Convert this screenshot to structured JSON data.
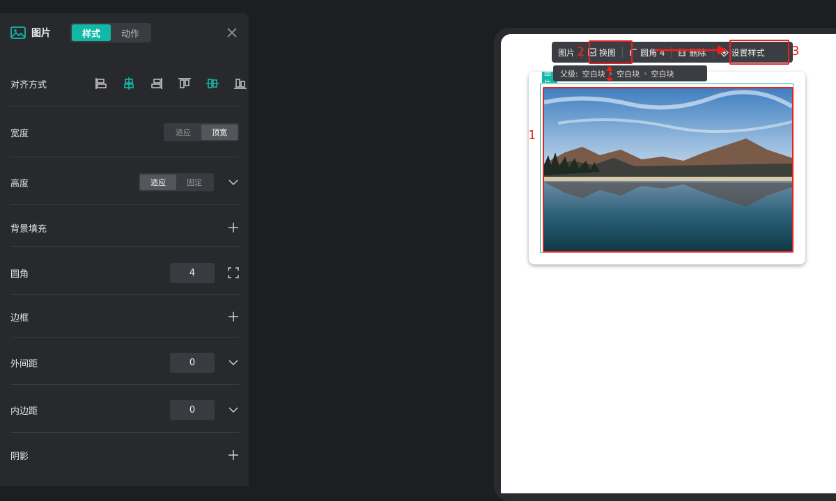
{
  "panel": {
    "title": "图片",
    "tabs": [
      {
        "label": "样式",
        "active": true
      },
      {
        "label": "动作",
        "active": false
      }
    ],
    "rows": {
      "align": {
        "label": "对齐方式"
      },
      "width": {
        "label": "宽度",
        "options": [
          "适应",
          "顶宽"
        ],
        "selected": "顶宽"
      },
      "height": {
        "label": "高度",
        "options": [
          "适应",
          "固定"
        ],
        "selected": "适应"
      },
      "background": {
        "label": "背景填充"
      },
      "radius": {
        "label": "圆角",
        "value": "4"
      },
      "border": {
        "label": "边框"
      },
      "margin": {
        "label": "外间距",
        "value": "0"
      },
      "padding": {
        "label": "内边距",
        "value": "0"
      },
      "shadow": {
        "label": "阴影"
      }
    }
  },
  "toolbar": {
    "item_image": "图片",
    "replace": "换图",
    "radius": "圆角 4",
    "delete": "删除",
    "set_style": "设置样式"
  },
  "breadcrumb": {
    "prefix": "父级:",
    "items": [
      "空白块",
      "空白块",
      "空白块"
    ]
  },
  "element_tag": "图片",
  "annotations": {
    "one": "1",
    "two": "2",
    "three": "3"
  },
  "colors": {
    "accent": "#12b8a6",
    "annotation": "#e8231f"
  }
}
